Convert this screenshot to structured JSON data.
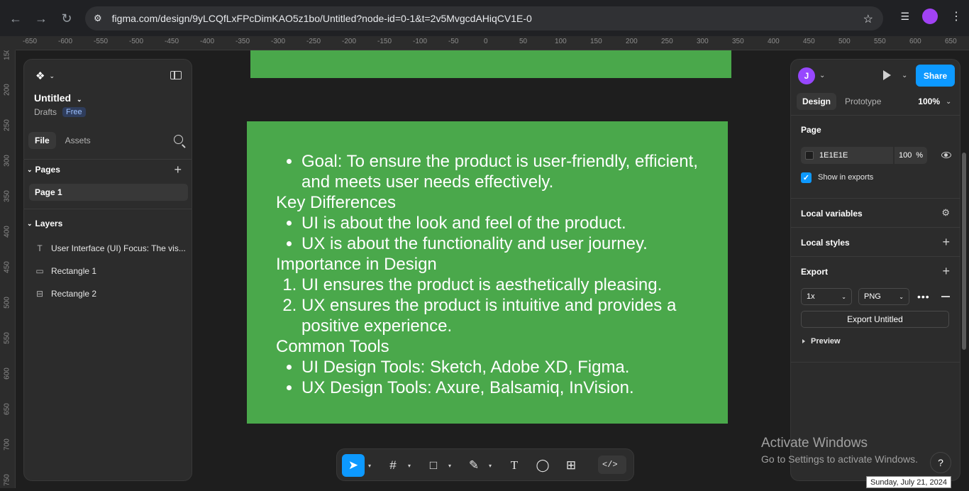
{
  "browser": {
    "url": "figma.com/design/9yLCQfLxFPcDimKAO5z1bo/Untitled?node-id=0-1&t=2v5MvgcdAHiqCV1E-0",
    "back_icon": "arrow-left-icon",
    "forward_icon": "arrow-right-icon",
    "reload_icon": "reload-icon"
  },
  "ruler": {
    "top_ticks": [
      "-650",
      "-600",
      "-550",
      "-500",
      "-450",
      "-400",
      "-350",
      "-300",
      "-250",
      "-200",
      "-150",
      "-100",
      "-50",
      "0",
      "50",
      "100",
      "150",
      "200",
      "250",
      "300",
      "350",
      "400",
      "450",
      "500",
      "550",
      "600",
      "650"
    ],
    "left_ticks": [
      "150",
      "200",
      "250",
      "300",
      "350",
      "400",
      "450",
      "500",
      "550",
      "600",
      "650",
      "700",
      "750"
    ]
  },
  "left_panel": {
    "file_title": "Untitled",
    "drafts": "Drafts",
    "plan_badge": "Free",
    "tabs": [
      "File",
      "Assets"
    ],
    "pages_heading": "Pages",
    "page_name": "Page 1",
    "layers_heading": "Layers",
    "layers": [
      {
        "icon": "T",
        "name": "User Interface (UI) Focus: The vis..."
      },
      {
        "icon": "▭",
        "name": "Rectangle 1"
      },
      {
        "icon": "⊟",
        "name": "Rectangle 2"
      }
    ]
  },
  "canvas": {
    "shape_color": "#4aa84b",
    "text": {
      "goal": [
        "Goal: To ensure the product is user-friendly, efficient, and meets user needs effectively."
      ],
      "heading1": "Key Differences",
      "diff": [
        "UI is about the look and feel of the product.",
        "UX is about the functionality and user journey."
      ],
      "heading2": "Importance in Design",
      "importance": [
        "UI ensures the product is aesthetically pleasing.",
        "UX ensures the product is intuitive and provides a positive experience."
      ],
      "heading3": "Common Tools",
      "tools": [
        "UI Design Tools: Sketch, Adobe XD, Figma.",
        "UX Design Tools: Axure, Balsamiq, InVision."
      ]
    }
  },
  "right_panel": {
    "avatar_letter": "J",
    "share": "Share",
    "tabs": [
      "Design",
      "Prototype"
    ],
    "zoom": "100%",
    "page_label": "Page",
    "bg_color": "1E1E1E",
    "bg_opacity": "100",
    "percent": "%",
    "show_in_exports": "Show in exports",
    "local_variables": "Local variables",
    "local_styles": "Local styles",
    "export_label": "Export",
    "scale": "1x",
    "format": "PNG",
    "export_button": "Export Untitled",
    "preview": "Preview"
  },
  "toolbar": {
    "tools": [
      "move-icon",
      "frame-icon",
      "rectangle-icon",
      "pen-icon",
      "text-icon",
      "comment-icon",
      "actions-icon",
      "dev-mode-icon"
    ]
  },
  "os": {
    "activate_title": "Activate Windows",
    "activate_sub": "Go to Settings to activate Windows.",
    "date": "Sunday, July 21, 2024",
    "help": "?"
  }
}
